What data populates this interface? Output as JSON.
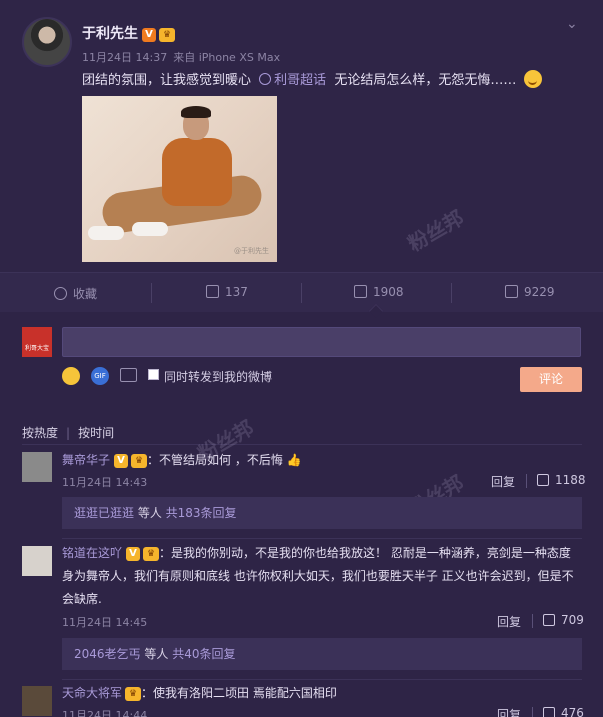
{
  "post": {
    "author": "于利先生",
    "verified_badge": "V",
    "date": "11月24日 14:37",
    "source": "来自 iPhone XS Max",
    "text_before": "团结的氛围，让我感觉到暖心",
    "topic": "利哥超话",
    "text_after": "无论结局怎么样，无怨无悔……",
    "photo_watermark": "@于利先生",
    "page_watermark": "粉丝邦"
  },
  "actions": {
    "favorite": "收藏",
    "repost": "137",
    "comment": "1908",
    "like": "9229"
  },
  "composer": {
    "avatar_text": "利哥大宝",
    "gif_label": "GIF",
    "repost_checkbox": "同时转发到我的微博",
    "submit": "评论"
  },
  "sort": {
    "by_hot": "按热度",
    "by_time": "按时间"
  },
  "comments": [
    {
      "name": "舞帝华子",
      "text": "：不管结局如何 ，不后悔",
      "time": "11月24日 14:43",
      "reply": "回复",
      "likes": "1188",
      "sub_name": "逛逛已逛逛",
      "sub_rest": " 等人 ",
      "sub_count": "共183条回复"
    },
    {
      "name": "铭道在这吖",
      "text_line1": "：是我的你别动，不是我的你也给我放这！ 忍耐是一种涵养，亮剑是一种态度",
      "text_line2": "身为舞帝人，我们有原则和底线 也许你权利大如天，我们也要胜天半子 正义也许会迟到，但是不",
      "text_line3": "会缺席.",
      "time": "11月24日 14:45",
      "reply": "回复",
      "likes": "709",
      "sub_name": "2046老乞丐",
      "sub_rest": " 等人 ",
      "sub_count": "共40条回复"
    },
    {
      "name": "天命大将军",
      "text": "：使我有洛阳二顷田 焉能配六国相印",
      "time": "11月24日 14:44",
      "reply": "回复",
      "likes": "476"
    }
  ]
}
